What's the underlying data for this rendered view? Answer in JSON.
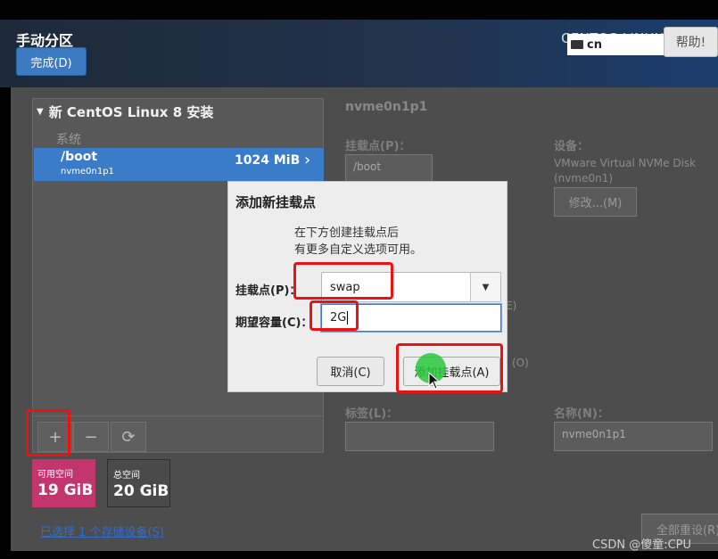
{
  "header": {
    "title": "手动分区",
    "done_label": "完成(D)",
    "product": "CENTOS LINUX 8 安装",
    "keyboard_layout": "cn",
    "help_label": "帮助!"
  },
  "left_panel": {
    "install_heading": "新 CentOS Linux 8 安装",
    "section_label": "系统",
    "mount": {
      "mount_point": "/boot",
      "device": "nvme0n1p1",
      "size": "1024 MiB"
    },
    "tools": {
      "add": "+",
      "remove": "−",
      "refresh": "⟳"
    }
  },
  "space": {
    "available_label": "可用空间",
    "available_value": "19 GiB",
    "total_label": "总空间",
    "total_value": "20 GiB"
  },
  "storage_link": "已选择 1 个存储设备(S)",
  "right_panel": {
    "title": "nvme0n1p1",
    "mount_label": "挂载点(P)：",
    "mount_value": "/boot",
    "device_label": "设备：",
    "device_text_1": "VMware Virtual NVMe Disk",
    "device_text_2": "(nvme0n1)",
    "modify_label": "修改...(M)",
    "tag_label": "标签(L)：",
    "name_label": "名称(N)：",
    "name_value": "nvme0n1p1",
    "ghost_1": "E)",
    "ghost_2": "(O)",
    "reset_label": "全部重设(R)"
  },
  "dialog": {
    "title": "添加新挂载点",
    "desc_line_1": "在下方创建挂载点后",
    "desc_line_2": "有更多自定义选项可用。",
    "mount_label": "挂载点(P)：",
    "mount_value": "swap",
    "capacity_label": "期望容量(C)：",
    "capacity_value": "2G",
    "cancel_label": "取消(C)",
    "add_label": "添加挂载点(A)"
  },
  "watermark": "CSDN @傻童:CPU",
  "colors": {
    "selection": "#3a7cc7",
    "available_space": "#c2356d",
    "total_space": "#4a4a4a",
    "highlight": "#ee1111",
    "click_indicator": "#28c83c"
  }
}
